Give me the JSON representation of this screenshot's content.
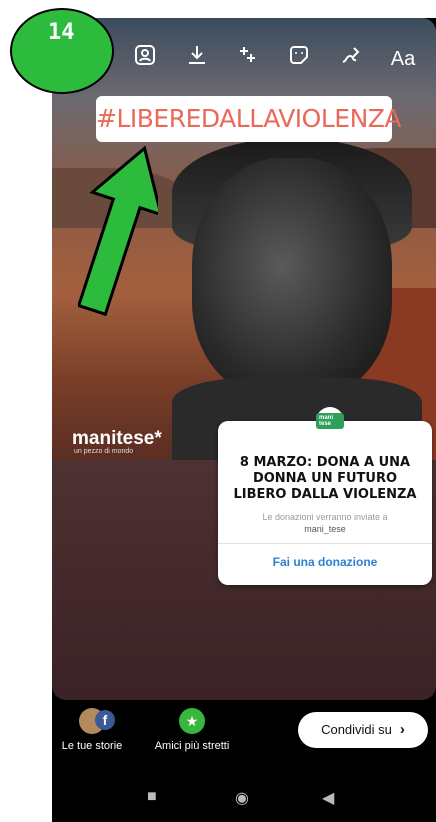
{
  "step_badge": "14",
  "toolbar": {
    "icons": [
      "sticker-person-icon",
      "download-icon",
      "effects-sparkle-icon",
      "sticker-icon",
      "draw-icon"
    ],
    "text_tool_label": "Aa"
  },
  "story": {
    "hashtag": "#LIBEREDALLAVIOLENZA",
    "brand": "manitese*",
    "brand_tagline": "un pezzo di mondo"
  },
  "donation_card": {
    "logo": "mani tese",
    "title": "8 MARZO: DONA A UNA DONNA UN FUTURO LIBERO DALLA VIOLENZA",
    "subtitle": "Le donazioni verranno inviate a",
    "account": "mani_tese",
    "cta": "Fai una donazione"
  },
  "share": {
    "your_stories_label": "Le tue storie",
    "close_friends_label": "Amici più stretti",
    "share_button_label": "Condividi su"
  },
  "colors": {
    "hashtag": "#ea6a5a",
    "cta": "#2f7fd0",
    "badge": "#2dbb3e"
  }
}
